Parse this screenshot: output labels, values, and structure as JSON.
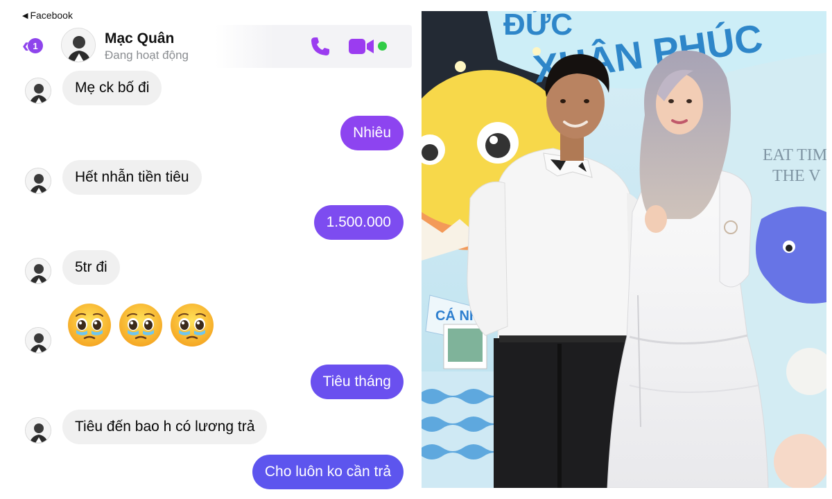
{
  "status_bar": {
    "back_app_label": "Facebook"
  },
  "header": {
    "unread_count": "1",
    "contact_name": "Mạc Quân",
    "contact_status": "Đang hoạt động"
  },
  "messages": [
    {
      "from": "them",
      "text": "Mẹ ck bố đi"
    },
    {
      "from": "me",
      "text": "Nhiêu"
    },
    {
      "from": "them",
      "text": "Hết nhẫn tiền tiêu"
    },
    {
      "from": "me",
      "text": "1.500.000"
    },
    {
      "from": "them",
      "text": "5tr đi"
    },
    {
      "from": "them",
      "emoji": "pleading-face",
      "count": 3
    },
    {
      "from": "me",
      "text": "Tiêu tháng"
    },
    {
      "from": "them",
      "text": "Tiêu đến bao h có lương trả"
    },
    {
      "from": "me",
      "text": "Cho luôn ko cần trả"
    }
  ],
  "colors": {
    "accent_purple": "#8e44ec",
    "bubble_out_top": "#9a3ff0",
    "bubble_out_bottom": "#5a56ee",
    "bubble_in": "#f0f0f0",
    "online_green": "#31cc46"
  },
  "photo": {
    "banner_text_top": "ĐỨC",
    "banner_text_main": "XUÂN PHÚC",
    "backdrop_sign_text": "CÁ NH",
    "wall_text_1": "EAT TIM",
    "wall_text_2": "THE V"
  }
}
